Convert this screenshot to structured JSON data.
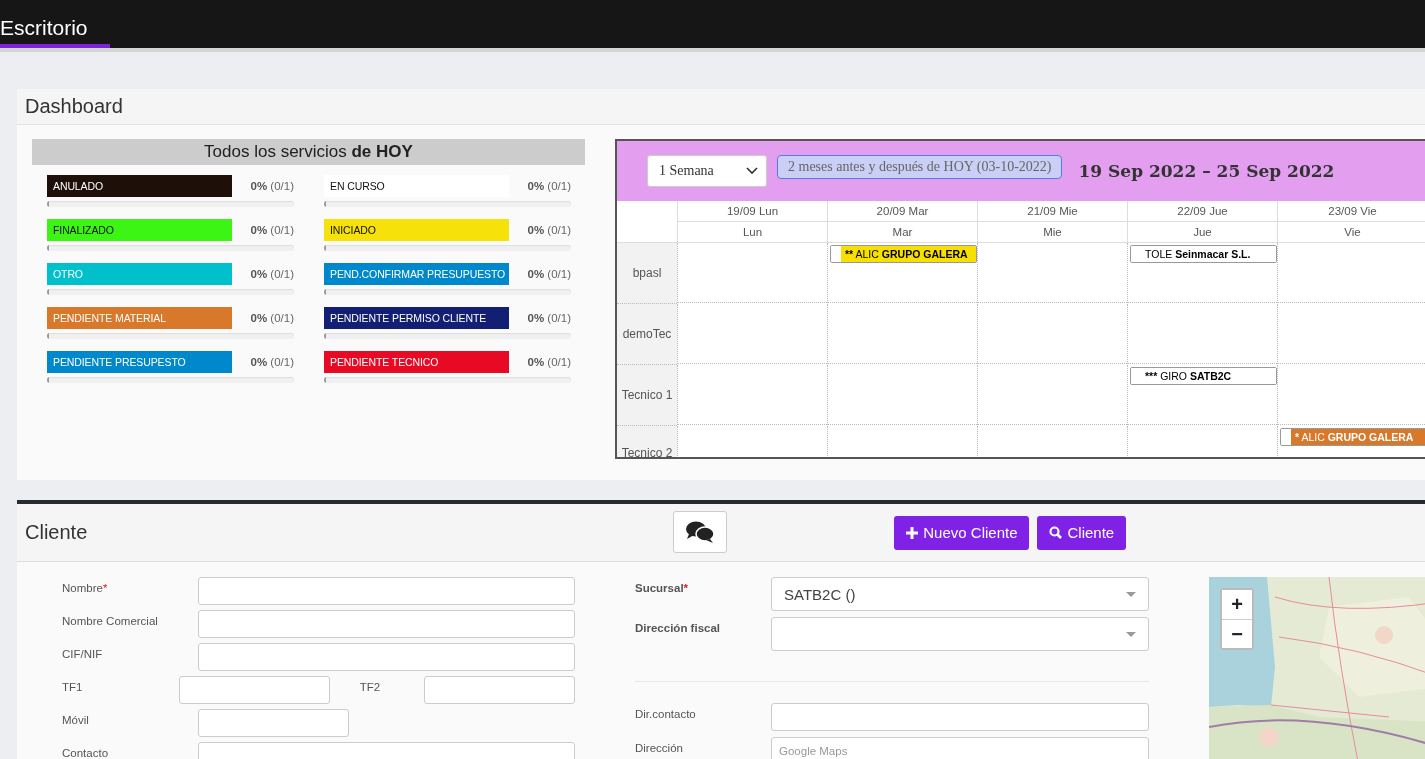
{
  "topbar": {
    "tabs": [
      {
        "label": "Escritorio",
        "selected": true
      }
    ]
  },
  "dashboard": {
    "title": "Dashboard",
    "services": {
      "title": "Todos los servicios **de HOY**",
      "items": [
        {
          "label": "ANULADO",
          "color": "#1e0f08",
          "percent": "0%",
          "count": "(0/1)",
          "level": 0
        },
        {
          "label": "EN CURSO",
          "color": "#ffffff",
          "percent": "0%",
          "count": "(0/1)",
          "level": 0
        },
        {
          "label": "FINALIZADO",
          "color": "#3cf514",
          "percent": "0%",
          "count": "(0/1)",
          "level": 0
        },
        {
          "label": "INICIADO",
          "color": "#f7e10a",
          "percent": "0%",
          "count": "(0/1)",
          "level": 0
        },
        {
          "label": "OTRO",
          "color": "#00c0cc",
          "percent": "0%",
          "count": "(0/1)",
          "level": 0
        },
        {
          "label": "PEND.CONFIRMAR PRESUPUESTO",
          "color": "#0088cc",
          "percent": "0%",
          "count": "(0/1)",
          "level": 0
        },
        {
          "label": "PENDIENTE MATERIAL",
          "color": "#d8782a",
          "percent": "0%",
          "count": "(0/1)",
          "level": 0
        },
        {
          "label": "PENDIENTE PERMISO CLIENTE",
          "color": "#121f72",
          "percent": "0%",
          "count": "(0/1)",
          "level": 0
        },
        {
          "label": "PENDIENTE PRESUPESTO",
          "color": "#0088cc",
          "percent": "0%",
          "count": "(0/1)",
          "level": 0
        },
        {
          "label": "PENDIENTE TECNICO",
          "color": "#e80a24",
          "percent": "0%",
          "count": "(0/1)",
          "level": 0
        }
      ]
    },
    "calendar": {
      "range_select": "1 Semana",
      "range_button": "2 meses antes y después de HOY (03-10-2022)",
      "title": "19 Sep 2022 – 25 Sep 2022",
      "days": [
        {
          "date": "19/09 Lun",
          "weekday": "Lun"
        },
        {
          "date": "20/09 Mar",
          "weekday": "Mar"
        },
        {
          "date": "21/09 Mie",
          "weekday": "Mie"
        },
        {
          "date": "22/09 Jue",
          "weekday": "Jue"
        },
        {
          "date": "23/09 Vie",
          "weekday": "Vie"
        }
      ],
      "resources": [
        {
          "name": "bpasl",
          "cells": [
            null,
            {
              "event": {
                "marker": "**",
                "code": "ALIC",
                "name": "GRUPO GALERA",
                "color": "#f7e000"
              }
            },
            null,
            {
              "event": {
                "code": "TOLE",
                "name": "Seinmacar S.L.",
                "color": "#ffffff"
              }
            },
            null
          ]
        },
        {
          "name": "demoTec",
          "cells": [
            null,
            null,
            null,
            null,
            null
          ]
        },
        {
          "name": "Tecnico 1",
          "cells": [
            null,
            null,
            null,
            {
              "event": {
                "marker": "***",
                "code": "GIRO",
                "name": "SATB2C",
                "color": "#ffffff"
              }
            },
            null
          ]
        },
        {
          "name": "Tecnico 2",
          "cells": [
            null,
            null,
            null,
            null,
            {
              "event": {
                "marker": "*",
                "code": "ALIC",
                "name": "GRUPO GALERA",
                "color": "#d8782a"
              }
            }
          ]
        }
      ]
    }
  },
  "cliente": {
    "title": "Cliente",
    "buttons": [
      {
        "kind": "new",
        "label": "Nuevo Cliente"
      },
      {
        "kind": "search",
        "label": "Cliente"
      }
    ],
    "left_rows": [
      {
        "kind": "wide",
        "fields": [
          {
            "label": "Nombre",
            "mark": "*"
          }
        ]
      },
      {
        "kind": "wide",
        "fields": [
          {
            "label": "Nombre Comercial"
          }
        ]
      },
      {
        "kind": "wide",
        "fields": [
          {
            "label": "CIF/NIF"
          }
        ]
      },
      {
        "kind": "pair",
        "fields": [
          {
            "label": "TF1"
          },
          {
            "label": "TF2"
          }
        ]
      },
      {
        "kind": "short",
        "fields": [
          {
            "label": "Móvil"
          }
        ]
      },
      {
        "kind": "wide",
        "fields": [
          {
            "label": "Contacto"
          }
        ]
      }
    ],
    "right_rows": [
      {
        "kind": "select",
        "label": "Sucursal",
        "mark": "*",
        "value": "SATB2C ()"
      },
      {
        "kind": "select",
        "label": "Dirección fiscal"
      },
      {
        "kind": "divider"
      },
      {
        "kind": "input",
        "label": "Dir.contacto"
      },
      {
        "kind": "input",
        "label": "Dirección",
        "placeholder": "Google Maps"
      }
    ],
    "map": {
      "zoom_in": "+",
      "zoom_out": "−"
    }
  }
}
